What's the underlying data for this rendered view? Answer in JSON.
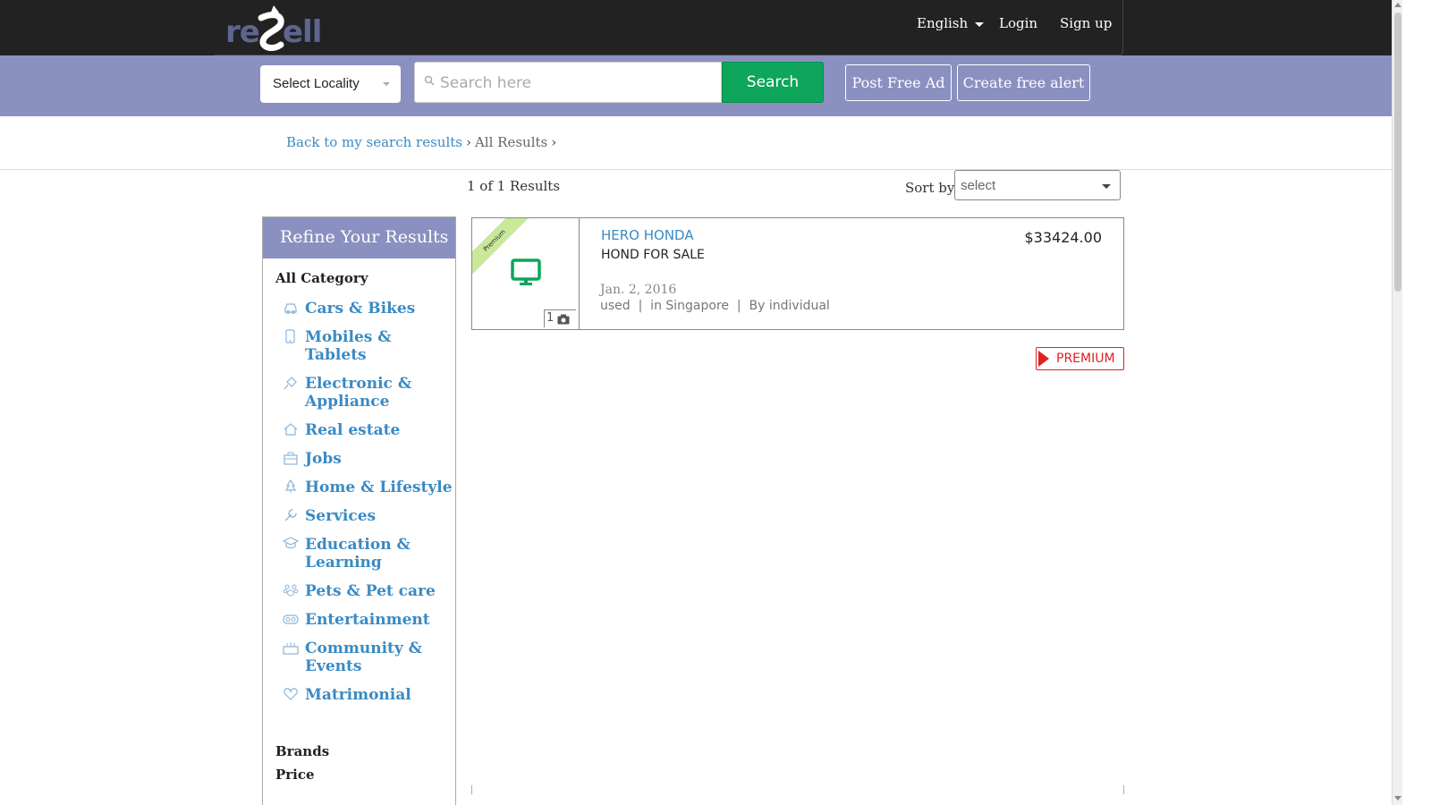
{
  "header": {
    "logo_text": "resell",
    "language": "English",
    "login": "Login",
    "signup": "Sign up"
  },
  "search": {
    "locality": "Select Locality",
    "placeholder": "Search here",
    "button": "Search",
    "post_ad": "Post Free Ad",
    "create_alert": "Create free alert"
  },
  "breadcrumb": {
    "back": "Back to my search results",
    "current": "All Results",
    "sep": "›"
  },
  "results": {
    "count": "1 of 1 Results",
    "sort_label": "Sort by",
    "sort_value": "select"
  },
  "sidebar": {
    "heading": "Refine Your Results",
    "all_category": "All Category",
    "categories": [
      {
        "label": "Cars & Bikes",
        "icon": "car-icon"
      },
      {
        "label": "Mobiles & Tablets",
        "icon": "mobile-icon"
      },
      {
        "label": "Electronic & Appliance",
        "icon": "plug-icon"
      },
      {
        "label": "Real estate",
        "icon": "house-icon"
      },
      {
        "label": "Jobs",
        "icon": "briefcase-icon"
      },
      {
        "label": "Home & Lifestyle",
        "icon": "tree-icon"
      },
      {
        "label": "Services",
        "icon": "wrench-icon"
      },
      {
        "label": "Education & Learning",
        "icon": "graduation-cap-icon"
      },
      {
        "label": "Pets & Pet care",
        "icon": "paw-icon"
      },
      {
        "label": "Entertainment",
        "icon": "gamepad-icon"
      },
      {
        "label": "Community & Events",
        "icon": "people-icon"
      },
      {
        "label": "Matrimonial",
        "icon": "heart-icon"
      }
    ],
    "brands": "Brands",
    "price": "Price"
  },
  "listing": {
    "ribbon": "Premium",
    "photo_count": "1",
    "title": "HERO HONDA",
    "subtitle": "HOND FOR SALE",
    "date": "Jan. 2, 2016",
    "meta": "used  |  in Singapore  |  By individual",
    "price": "$33424.00"
  },
  "premium_badge": "PREMIUM",
  "colors": {
    "topbar": "#222222",
    "searchbar": "#8a90c0",
    "link": "#3a8ac4",
    "search_button": "#0da65a",
    "premium": "#e02020",
    "ribbon": "#c8e89a"
  }
}
